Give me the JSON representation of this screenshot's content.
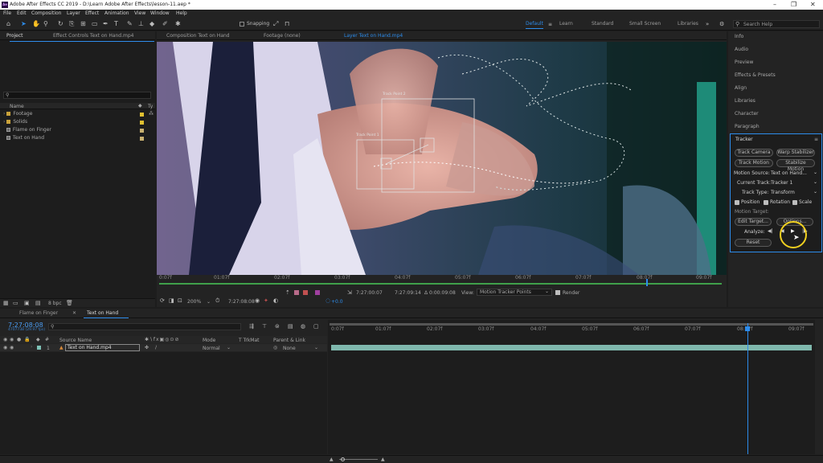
{
  "window": {
    "title": "Adobe After Effects CC 2019 - D:\\Learn Adobe After Effects\\lesson-11.aep *",
    "app_icon": "Ae"
  },
  "menu": [
    "File",
    "Edit",
    "Composition",
    "Layer",
    "Effect",
    "Animation",
    "View",
    "Window",
    "Help"
  ],
  "toolbar": {
    "snapping_label": "Snapping",
    "workspaces": [
      {
        "label": "Default",
        "active": true
      },
      {
        "label": "Learn",
        "active": false
      },
      {
        "label": "Standard",
        "active": false
      },
      {
        "label": "Small Screen",
        "active": false
      },
      {
        "label": "Libraries",
        "active": false
      }
    ],
    "search_placeholder": "Search Help"
  },
  "project_panel": {
    "tabs": [
      "Project",
      "Effect Controls Text on Hand.mp4"
    ],
    "search_placeholder": "",
    "columns": [
      "Name",
      "Ty"
    ],
    "items": [
      {
        "name": "Footage",
        "type": "folder",
        "color": "#e0c030"
      },
      {
        "name": "Solids",
        "type": "folder",
        "color": "#e0c030"
      },
      {
        "name": "Flame on Finger",
        "type": "composition",
        "color": "#c8b070"
      },
      {
        "name": "Text on Hand",
        "type": "composition",
        "color": "#c8b070"
      }
    ],
    "bpc": "8 bpc"
  },
  "viewer": {
    "tabs": [
      "Composition Text on Hand",
      "Footage (none)",
      "Layer Text on Hand.mp4"
    ],
    "track_points": [
      "Track Point 1",
      "Track Point 2"
    ],
    "ruler": [
      "0:07f",
      "01:07f",
      "02:07f",
      "03:07f",
      "04:07f",
      "05:07f",
      "06:07f",
      "07:07f",
      "08:07f",
      "09:07f"
    ],
    "zoom": "200%",
    "current_time": "7:27:08:08",
    "in_time": "7:27:00:07",
    "out_time": "7:27:09:14",
    "duration": "Δ 0:00:09:08",
    "view_label": "View:",
    "view_value": "Motion Tracker Points",
    "render_label": "Render",
    "exposure": "+0.0"
  },
  "right_panels": [
    "Info",
    "Audio",
    "Preview",
    "Effects & Presets",
    "Align",
    "Libraries",
    "Character",
    "Paragraph"
  ],
  "tracker": {
    "title": "Tracker",
    "buttons": [
      "Track Camera",
      "Warp Stabilizer",
      "Track Motion",
      "Stabilize Motion"
    ],
    "motion_source_label": "Motion Source:",
    "motion_source_value": "Text on Hand...",
    "current_track_label": "Current Track:",
    "current_track_value": "Tracker 1",
    "track_type_label": "Track Type:",
    "track_type_value": "Transform",
    "options": [
      "Position",
      "Rotation",
      "Scale"
    ],
    "motion_target_label": "Motion Target:",
    "edit_target": "Edit Target...",
    "options_button": "Options...",
    "analyze_label": "Analyze:",
    "reset": "Reset"
  },
  "timeline": {
    "tabs": [
      "Flame on Finger",
      "Text on Hand"
    ],
    "timecode": "7:27:08:08",
    "timecode_sub": "4707738 (29.97 fps)",
    "columns": [
      "Source Name",
      "Mode",
      "T TrkMat",
      "Parent & Link"
    ],
    "layers": [
      {
        "index": "1",
        "name": "Text on Hand.mp4",
        "mode": "Normal",
        "parent": "None"
      }
    ],
    "ruler": [
      "0:07f",
      "01:07f",
      "02:07f",
      "03:07f",
      "04:07f",
      "05:07f",
      "06:07f",
      "07:07f",
      "08:07f",
      "09:07f"
    ],
    "playhead_fraction": 0.866
  }
}
